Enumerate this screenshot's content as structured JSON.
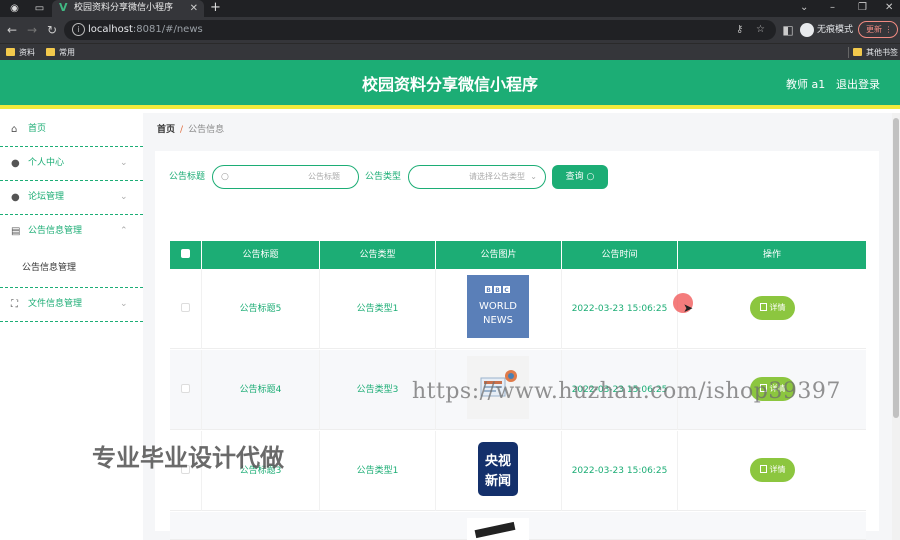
{
  "browser": {
    "tab_title": "校园资料分享微信小程序",
    "url_host": "localhost",
    "url_rest": ":8081/#/news",
    "incognito_label": "无痕模式",
    "update_label": "更新",
    "bookmarks": [
      "资料",
      "常用"
    ],
    "other_bookmarks": "其他书签"
  },
  "header": {
    "title": "校园资料分享微信小程序",
    "user": "教师 a1",
    "logout": "退出登录"
  },
  "sidebar": {
    "items": [
      {
        "label": "首页",
        "icon": "home-icon"
      },
      {
        "label": "个人中心",
        "icon": "user-icon"
      },
      {
        "label": "论坛管理",
        "icon": "user-icon"
      },
      {
        "label": "公告信息管理",
        "icon": "briefcase-icon"
      },
      {
        "label": "文件信息管理",
        "icon": "frame-icon"
      }
    ],
    "submenu": "公告信息管理"
  },
  "breadcrumb": {
    "home": "首页",
    "sep": "/",
    "current": "公告信息"
  },
  "search": {
    "title_label": "公告标题",
    "title_placeholder": "公告标题",
    "type_label": "公告类型",
    "type_placeholder": "请选择公告类型",
    "query_button": "查询"
  },
  "table": {
    "headers": [
      "公告标题",
      "公告类型",
      "公告图片",
      "公告时间",
      "操作"
    ],
    "detail_button": "详情",
    "rows": [
      {
        "title": "公告标题5",
        "type": "公告类型1",
        "image": "BBC WORLD NEWS",
        "time": "2022-03-23 15:06:25"
      },
      {
        "title": "公告标题4",
        "type": "公告类型3",
        "image": "news-illustration",
        "time": "2022-03-23 15:06:25"
      },
      {
        "title": "公告标题3",
        "type": "公告类型1",
        "image": "央视新闻",
        "time": "2022-03-23 15:06:25"
      }
    ]
  },
  "overlays": {
    "watermark_url": "https://www.huzhan.com/ishop39397",
    "watermark_cn": "专业毕业设计代做"
  },
  "colors": {
    "primary": "#1cad75",
    "accent_yellow": "#f1ea3c",
    "detail_green": "#8cc63f"
  }
}
